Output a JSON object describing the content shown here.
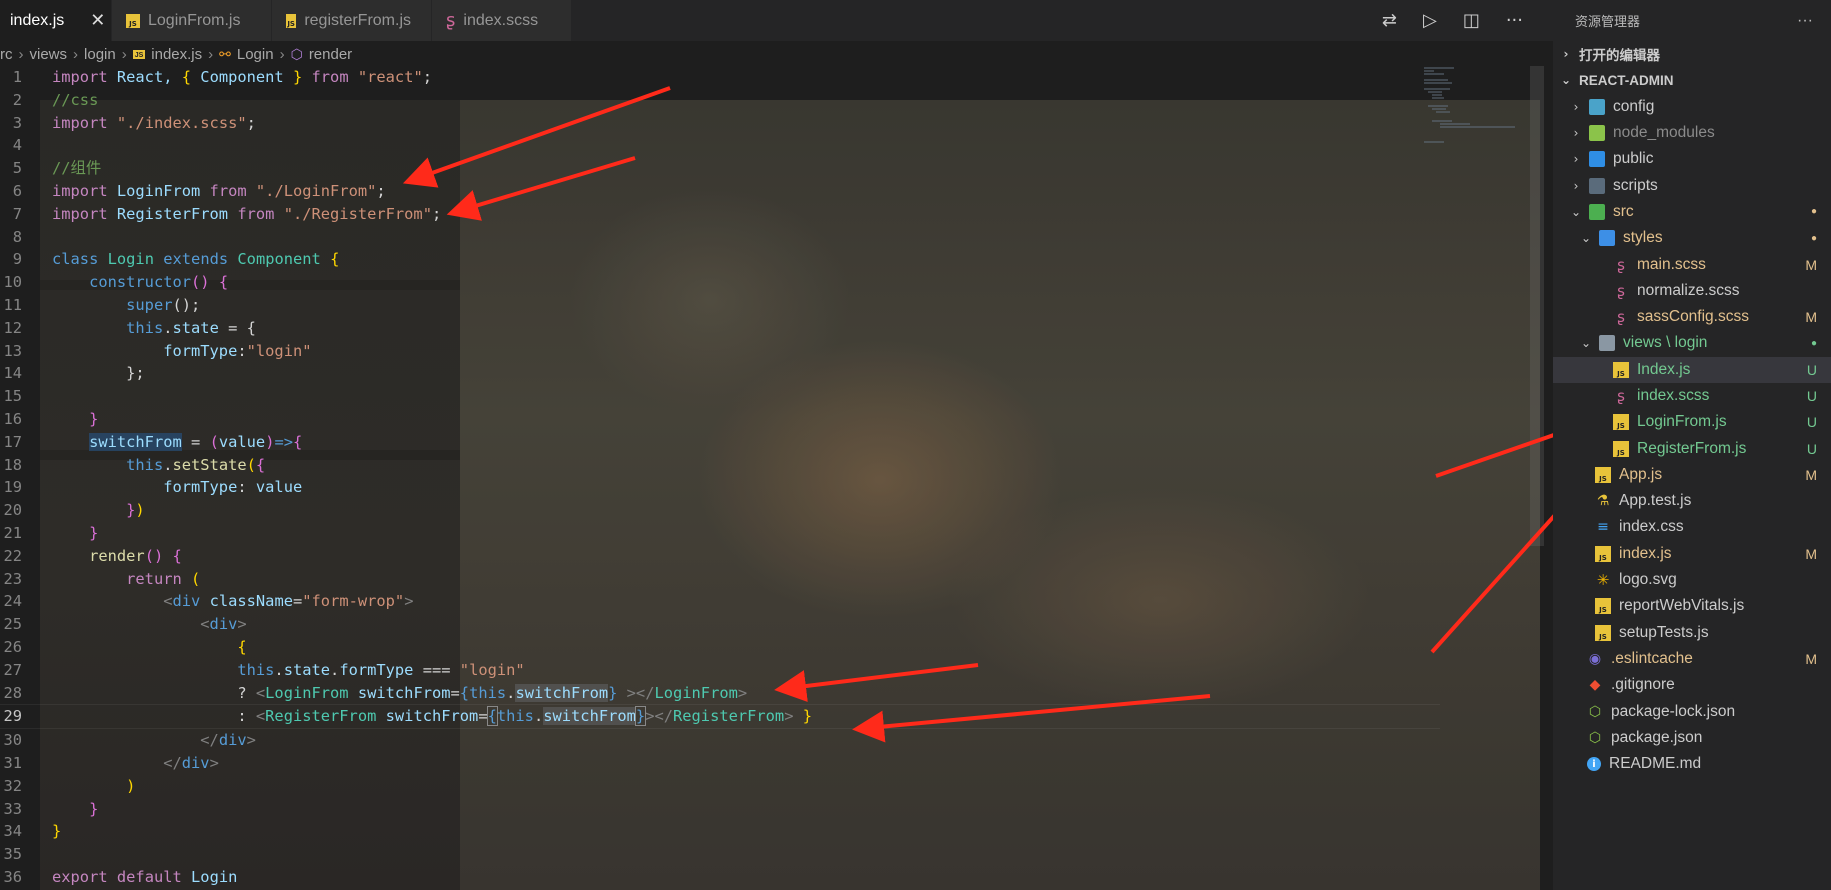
{
  "tabs": [
    {
      "label": "index.js",
      "icon": "none",
      "active": true
    },
    {
      "label": "LoginFrom.js",
      "icon": "js-icon"
    },
    {
      "label": "registerFrom.js",
      "icon": "js-icon"
    },
    {
      "label": "index.scss",
      "icon": "scss-icon"
    }
  ],
  "breadcrumb": {
    "p1": "rc",
    "p2": "views",
    "p3": "login",
    "p4": "index.js",
    "p5": "Login",
    "p6": "render"
  },
  "js_badge": "JS",
  "explorer": {
    "title": "资源管理器",
    "more": "···",
    "open_editors": "打开的编辑器",
    "project": "REACT-ADMIN",
    "items": [
      {
        "label": "config",
        "status": ""
      },
      {
        "label": "node_modules",
        "status": ""
      },
      {
        "label": "public",
        "status": ""
      },
      {
        "label": "scripts",
        "status": ""
      },
      {
        "label": "src",
        "status": "●"
      },
      {
        "label": "styles",
        "status": "●"
      },
      {
        "label": "main.scss",
        "status": "M"
      },
      {
        "label": "normalize.scss",
        "status": ""
      },
      {
        "label": "sassConfig.scss",
        "status": "M"
      },
      {
        "label": "views \\ login",
        "status": "●"
      },
      {
        "label": "Index.js",
        "status": "U"
      },
      {
        "label": "index.scss",
        "status": "U"
      },
      {
        "label": "LoginFrom.js",
        "status": "U"
      },
      {
        "label": "RegisterFrom.js",
        "status": "U"
      },
      {
        "label": "App.js",
        "status": "M"
      },
      {
        "label": "App.test.js",
        "status": ""
      },
      {
        "label": "index.css",
        "status": ""
      },
      {
        "label": "index.js",
        "status": "M"
      },
      {
        "label": "logo.svg",
        "status": ""
      },
      {
        "label": "reportWebVitals.js",
        "status": ""
      },
      {
        "label": "setupTests.js",
        "status": ""
      },
      {
        "label": ".eslintcache",
        "status": "M"
      },
      {
        "label": ".gitignore",
        "status": ""
      },
      {
        "label": "package-lock.json",
        "status": ""
      },
      {
        "label": "package.json",
        "status": ""
      },
      {
        "label": "README.md",
        "status": ""
      }
    ]
  },
  "code": {
    "l1": [
      "import",
      " React, ",
      "{",
      " Component ",
      "}",
      " from ",
      "\"react\"",
      ";"
    ],
    "l2": "//css",
    "l3": [
      "import",
      " ",
      "\"./index.scss\"",
      ";"
    ],
    "l5": "//组件",
    "l6": [
      "import",
      " LoginFrom ",
      "from",
      " ",
      "\"./LoginFrom\"",
      ";"
    ],
    "l7": [
      "import",
      " RegisterFrom ",
      "from",
      " ",
      "\"./RegisterFrom\"",
      ";"
    ],
    "l9": [
      "class",
      " ",
      "Login",
      " ",
      "extends",
      " ",
      "Component",
      " ",
      "{"
    ],
    "l10": [
      "constructor",
      "()",
      " {"
    ],
    "l11": [
      "super",
      "();"
    ],
    "l12": [
      "this",
      ".",
      "state",
      " = {"
    ],
    "l13": [
      "formType",
      ":",
      "\"login\""
    ],
    "l14": "};",
    "l16": "}",
    "l17": [
      "switchFrom",
      " = ",
      "(",
      "value",
      ")",
      "=>",
      "{"
    ],
    "l18": [
      "this",
      ".",
      "setState",
      "(",
      "{"
    ],
    "l19": [
      "formType",
      ": ",
      "value"
    ],
    "l20": [
      "}",
      ")"
    ],
    "l21": "}",
    "l22": [
      "render",
      "()",
      " {"
    ],
    "l23": [
      "return",
      " ("
    ],
    "l24": [
      "<",
      "div",
      " ",
      "className",
      "=",
      "\"form-wrop\"",
      ">"
    ],
    "l25": [
      "<",
      "div",
      ">"
    ],
    "l26": "{",
    "l27": [
      "this",
      ".",
      "state",
      ".",
      "formType",
      " === ",
      "\"login\""
    ],
    "l28": [
      "? ",
      "<",
      "LoginFrom",
      " ",
      "switchFrom",
      "=",
      "{",
      "this",
      ".",
      "switchFrom",
      "}",
      " ></",
      "LoginFrom",
      ">"
    ],
    "l29": [
      ": ",
      "<",
      "RegisterFrom",
      " ",
      "switchFrom",
      "=",
      "{",
      "this",
      ".",
      "switchFrom",
      "}",
      "></",
      "RegisterFrom",
      ">",
      " ",
      "}"
    ],
    "l30": [
      "</",
      "div",
      ">"
    ],
    "l31": [
      "</",
      "div",
      ">"
    ],
    "l32": ")",
    "l33": "}",
    "l34": "}",
    "l36": [
      "export",
      " ",
      "default",
      " Login"
    ]
  },
  "colors": {
    "accent_red": "#ff2a1a",
    "modified": "#e2c08d",
    "untracked": "#73c991"
  }
}
